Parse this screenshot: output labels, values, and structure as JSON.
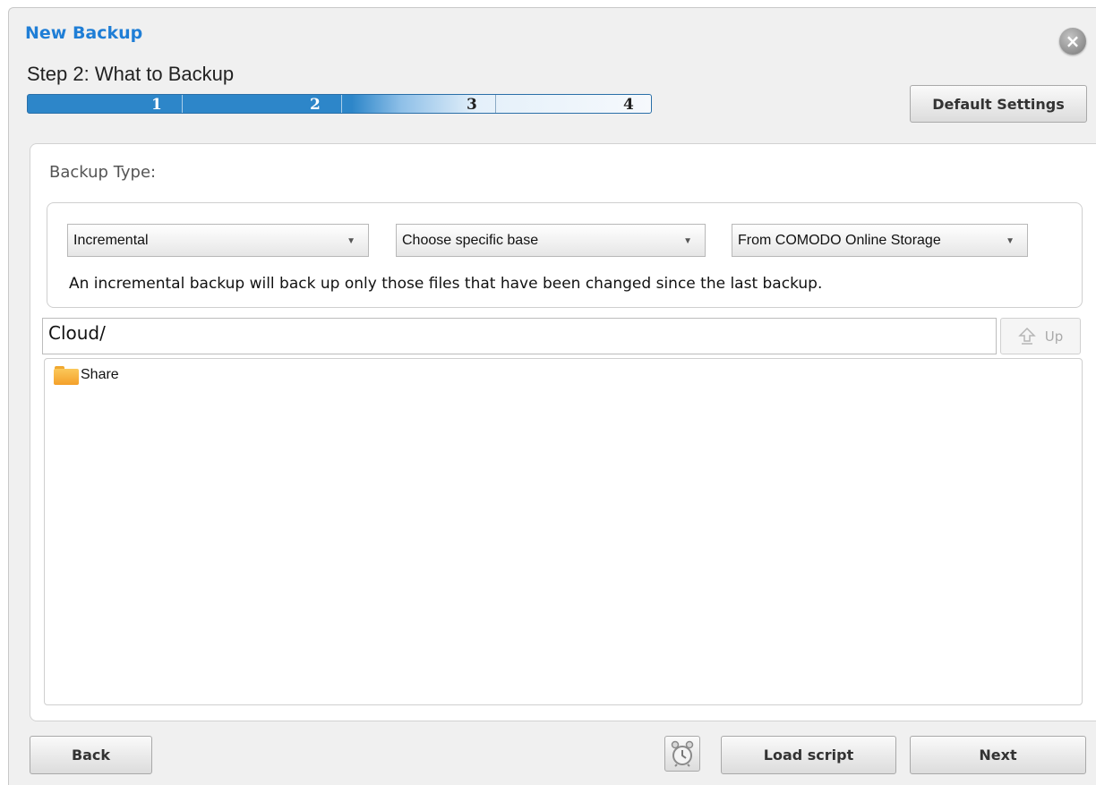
{
  "window": {
    "title": "New Backup",
    "close_glyph": "×"
  },
  "wizard": {
    "step_title": "Step 2: What to Backup",
    "steps": [
      "1",
      "2",
      "3",
      "4"
    ],
    "current_step": 2
  },
  "toolbar": {
    "default_settings_label": "Default Settings"
  },
  "backup_type": {
    "label": "Backup Type:",
    "type_select": "Incremental",
    "base_select": "Choose specific base",
    "source_select": "From COMODO Online Storage",
    "description": "An incremental backup will back up only those files that have been changed since the last backup."
  },
  "browser": {
    "path": "Cloud/",
    "up_label": "Up",
    "items": [
      {
        "name": "Share",
        "icon": "folder-icon"
      }
    ]
  },
  "footer": {
    "back_label": "Back",
    "load_script_label": "Load script",
    "next_label": "Next",
    "schedule_icon": "alarm-clock-icon"
  }
}
